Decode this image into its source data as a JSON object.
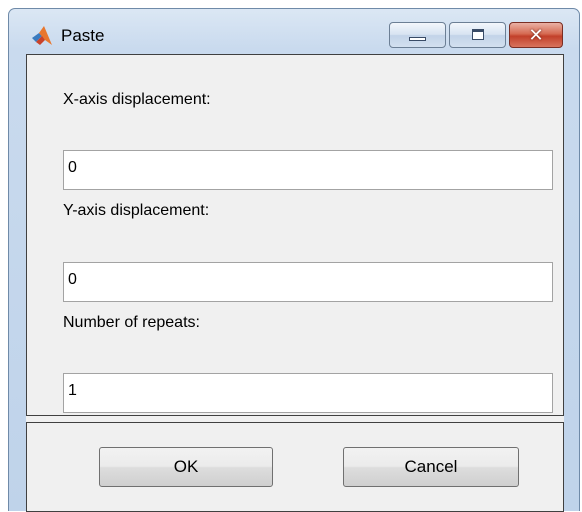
{
  "window": {
    "title": "Paste",
    "app_icon": "matlab-logo-icon",
    "controls": {
      "minimize_icon": "minimize-icon",
      "maximize_icon": "maximize-icon",
      "close_icon": "close-icon",
      "close_glyph": "✕"
    }
  },
  "form": {
    "x_label": "X-axis displacement:",
    "x_value": "0",
    "y_label": "Y-axis displacement:",
    "y_value": "0",
    "repeats_label": "Number of repeats:",
    "repeats_value": "1"
  },
  "buttons": {
    "ok_label": "OK",
    "cancel_label": "Cancel"
  },
  "colors": {
    "titlebar": "#c9daee",
    "client": "#f0f0f0",
    "close_button": "#c2402a"
  }
}
